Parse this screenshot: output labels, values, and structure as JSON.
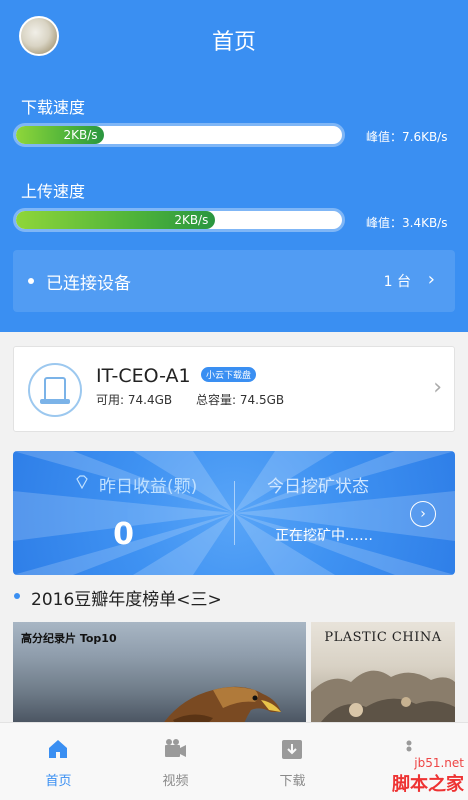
{
  "header": {
    "title": "首页"
  },
  "download": {
    "label": "下载速度",
    "speed": "2KB/s",
    "progress": 0.27,
    "peak": "峰值：7.6KB/s"
  },
  "upload": {
    "label": "上传速度",
    "speed": "2KB/s",
    "progress": 0.61,
    "peak": "峰值：3.4KB/s"
  },
  "devices": {
    "label": "已连接设备",
    "count": "1 台"
  },
  "device_card": {
    "name": "IT-CEO-A1",
    "tag": "小云下载盘",
    "free": "可用: 74.4GB",
    "total": "总容量: 74.5GB"
  },
  "mining": {
    "earn_label": "昨日收益(颗)",
    "earn_value": "0",
    "status_label": "今日挖矿状态",
    "status_value": "正在挖矿中……"
  },
  "ranking": {
    "title": "2016豆瓣年度榜单<三>",
    "poster1_title": "高分纪录片 Top10",
    "poster2_title": "PLASTIC CHINA"
  },
  "nav": {
    "items": [
      {
        "label": "首页",
        "icon": "home-icon"
      },
      {
        "label": "视频",
        "icon": "camera-icon"
      },
      {
        "label": "下载",
        "icon": "download-icon"
      },
      {
        "label": "",
        "icon": "more-icon"
      }
    ]
  },
  "watermark": {
    "line1": "jb51.net",
    "line2": "脚本之家"
  },
  "colors": {
    "primary": "#3a8ff2",
    "progress_green": "#4eb33a"
  }
}
